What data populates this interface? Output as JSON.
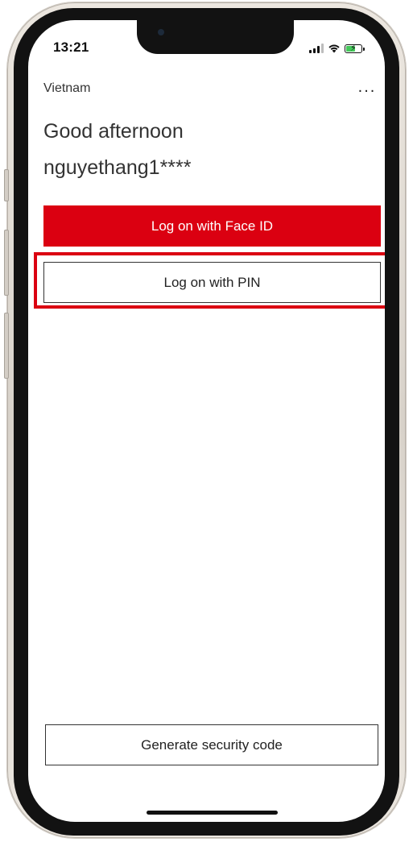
{
  "status_bar": {
    "time": "13:21",
    "signal_icon": "cellular-signal-icon",
    "wifi_icon": "wifi-icon",
    "battery_icon": "battery-charging-icon",
    "battery_color": "#44c85a"
  },
  "header": {
    "region": "Vietnam",
    "more_label": "..."
  },
  "greeting": {
    "line1": "Good afternoon",
    "username": "nguyethang1****"
  },
  "actions": {
    "face_id_label": "Log on with Face ID",
    "pin_label": "Log on with PIN",
    "security_code_label": "Generate security code"
  },
  "colors": {
    "brand_red": "#db0011",
    "text_dark": "#333333"
  }
}
